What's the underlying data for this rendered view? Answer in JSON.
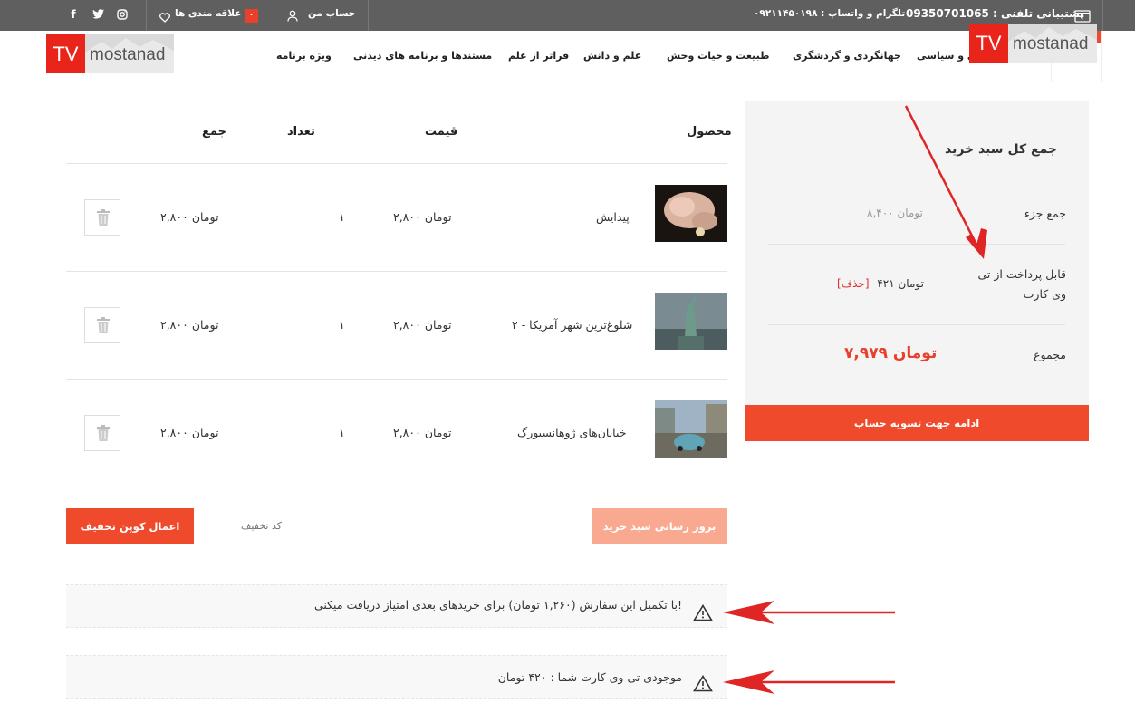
{
  "topbar": {
    "support_label": "پشتیبانی تلفنی : 09350701065",
    "telegram_label": "تلگرام و واتساپ : ۰۹۲۱۱۴۵۰۱۹۸",
    "account_label": "حساب من",
    "wishlist_label": "علاقه مندی ها",
    "wishlist_count": "۰",
    "social_icons": [
      "instagram-icon",
      "twitter-icon",
      "facebook-icon"
    ]
  },
  "logo": {
    "tv": "TV",
    "name": "mostanad"
  },
  "nav": {
    "items": [
      "ویژه برنامه",
      "مستندها و برنامه های دیدنی",
      "فراتر از علم",
      "علم و دانش",
      "طبیعت و حیات وحش",
      "جهانگردی و گردشگری",
      "ی و سیاسی"
    ]
  },
  "cart": {
    "headers": {
      "product": "محصول",
      "price": "قیمت",
      "qty": "تعداد",
      "total": "جمع"
    },
    "rows": [
      {
        "name": "پیدایش",
        "price": "۲,۸۰۰ تومان",
        "qty": "۱",
        "total": "۲,۸۰۰ تومان"
      },
      {
        "name": "شلوغ‌ترین شهر آمریکا - ۲",
        "price": "۲,۸۰۰ تومان",
        "qty": "۱",
        "total": "۲,۸۰۰ تومان"
      },
      {
        "name": "خیابان‌های ژوهانسبورگ",
        "price": "۲,۸۰۰ تومان",
        "qty": "۱",
        "total": "۲,۸۰۰ تومان"
      }
    ],
    "update_button": "بروز رسانی سبد خرید",
    "coupon_placeholder": "کد تخفیف",
    "apply_coupon": "اعمال کوپن تخفیف"
  },
  "notices": [
    "با تکمیل این سفارش (۱,۲۶۰ تومان) برای خریدهای بعدی امتیاز دریافت میکنی!",
    "موجودی تی وی کارت شما : ۴۲۰ تومان"
  ],
  "totals": {
    "title": "جمع کل سبد خرید",
    "subtotal_label": "جمع جزء",
    "subtotal_value": "۸,۴۰۰ تومان",
    "tvcard_label_1": "قابل پرداخت از تی",
    "tvcard_label_2": "وی کارت",
    "tvcard_value": "-۴۲۱ تومان",
    "tvcard_remove": "[حذف]",
    "total_label": "مجموع",
    "total_value": "۷,۹۷۹ تومان",
    "checkout_button": "ادامه جهت تسویه حساب"
  },
  "colors": {
    "accent": "#f04a2c",
    "annotation": "#e02525",
    "topbar": "#5f5f5f"
  }
}
